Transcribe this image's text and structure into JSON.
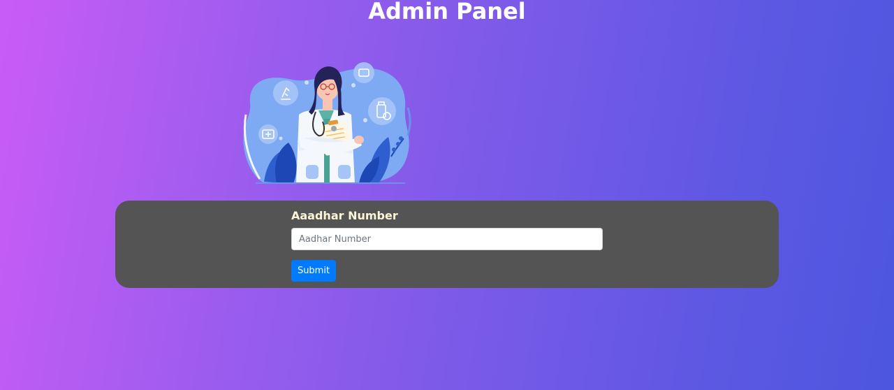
{
  "header": {
    "title": "Admin Panel"
  },
  "illustration": {
    "icon": "doctor-illustration"
  },
  "form": {
    "label": "Aaadhar Number",
    "input_value": "",
    "input_placeholder": "Aadhar Number",
    "submit_label": "Submit"
  },
  "colors": {
    "panel_bg": "#555454",
    "label_color": "#fdf6d6",
    "button_bg": "#007bff",
    "gradient_start": "#c95cf6",
    "gradient_end": "#4c56df"
  }
}
